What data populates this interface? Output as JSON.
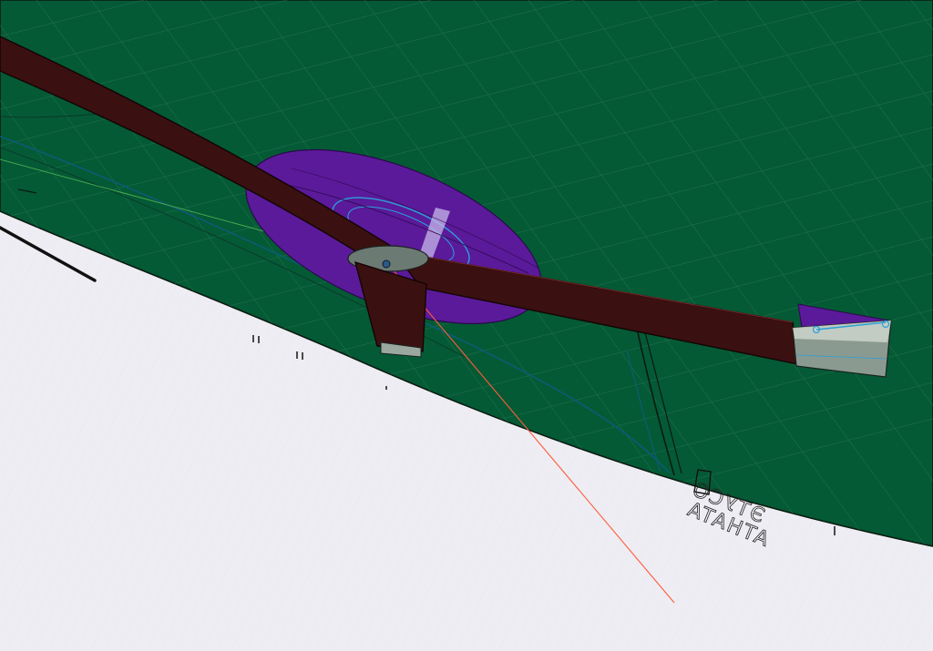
{
  "viewport": {
    "background": "#eeedf3",
    "ground_color": "#045a35",
    "grid_line_color": "#2f7a58",
    "beam_color": "#3b1010",
    "disc_color": "#5b1a9a",
    "bracket_color": "#8a9a90",
    "laser_color": "#ff5a3a"
  },
  "floor_text": {
    "line1": "ATHATA",
    "line2": "ЭТУСО"
  }
}
